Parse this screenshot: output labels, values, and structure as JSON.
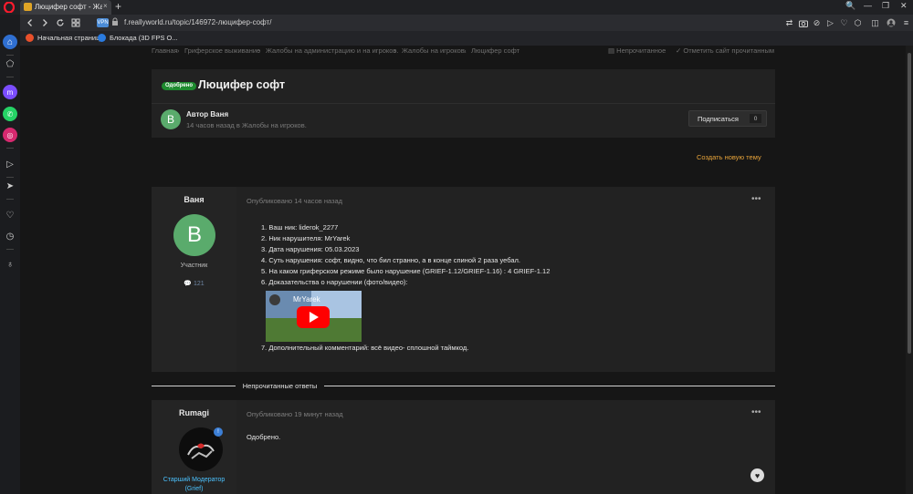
{
  "browser": {
    "tab_title": "Люцифер софт - Жалобы н...",
    "tab_close": "×",
    "new_tab": "+",
    "url": "f.reallyworld.ru/topic/146972-люцифер-софт/",
    "secure_badge": "VPN",
    "bookmarks": [
      {
        "label": "Начальная страница",
        "color": "#e8502b"
      },
      {
        "label": "Блокада (3D FPS О...",
        "color": "#2a7be0"
      }
    ],
    "window_controls": [
      "🔍",
      "—",
      "❐",
      "✕"
    ]
  },
  "breadcrumb": {
    "items": [
      "Главная",
      "Гриферское выживание",
      "Жалобы на администрацию и на игроков.",
      "Жалобы на игроков.",
      "Люцифер софт"
    ],
    "separator": "›",
    "unread_label": "Непрочитанное",
    "mark_read_label": "Отметить сайт прочитанным"
  },
  "topic": {
    "badge": "Одобрено",
    "title": "Люцифер софт",
    "author_initial": "B",
    "author_line": "Автор Ваня",
    "meta_line": "14 часов назад в Жалобы на игроков.",
    "subscribe_label": "Подписаться",
    "subscribe_count": "0",
    "new_topic_label": "Создать новую тему"
  },
  "post1": {
    "author": "Ваня",
    "avatar_initial": "B",
    "role": "Участник",
    "post_count": "121",
    "date": "Опубликовано 14 часов назад",
    "menu": "•••",
    "items": [
      "1. Ваш ник: liderok_2277",
      "2. Ник нарушителя: MrYarek",
      "3. Дата нарушения: 05.03.2023",
      "4. Суть нарушения: софт, видно, что бил странно, а в конце спиной 2 раза уебал.",
      "5. На каком гриферском режиме было нарушение (GRIEF-1.12/GRIEF-1.16) : 4 GRIEF-1.12",
      "6. Доказательства о нарушении (фото/видео):"
    ],
    "video_title": "MrYarek",
    "last_item": "7. Дополнительный комментарий: всё видео- сплошной таймкод."
  },
  "unread_separator": "Непрочитанные ответы",
  "post2": {
    "author": "Rumagi",
    "date": "Опубликовано 19 минут назад",
    "menu": "•••",
    "role_line1": "Старший Модератор",
    "role_line2": "(Grief)",
    "text": "Одобрено.",
    "badge": "!"
  }
}
